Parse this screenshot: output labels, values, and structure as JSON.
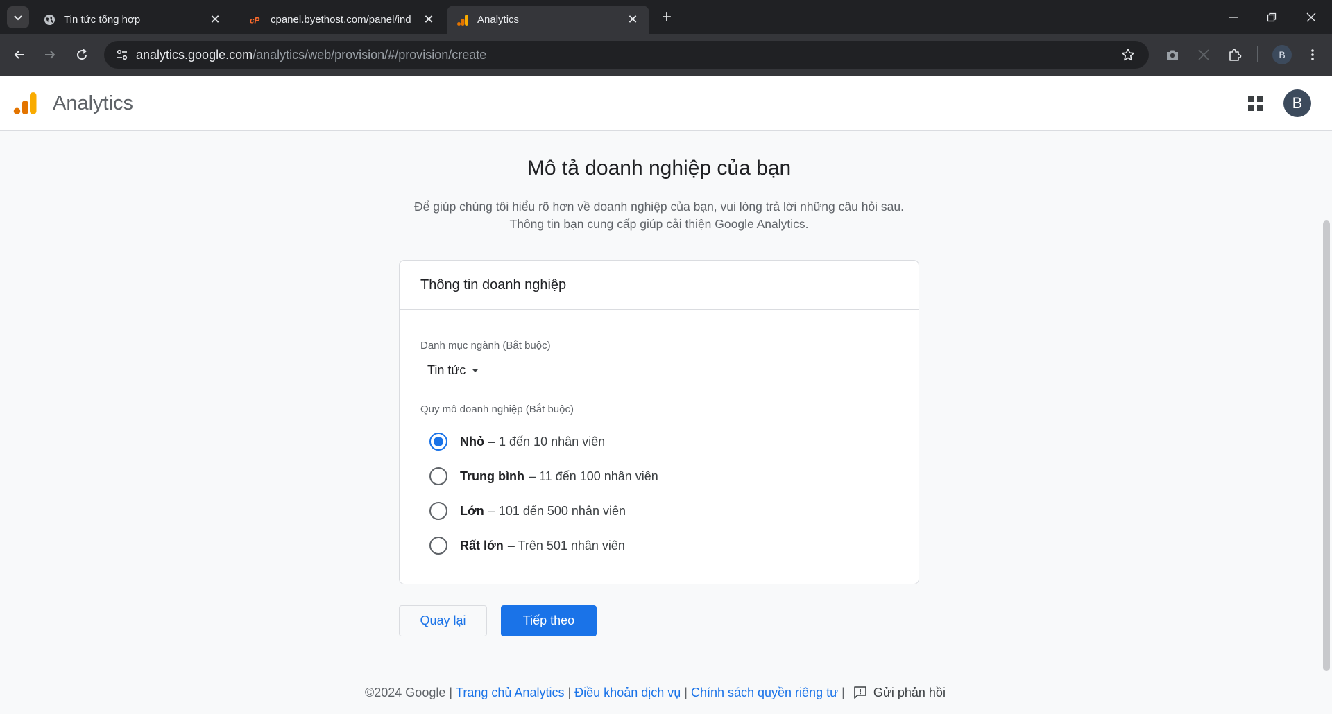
{
  "browser": {
    "tabs": [
      {
        "title": "Tin tức tổng hợp",
        "favicon": "globe-icon",
        "active": false
      },
      {
        "title": "cpanel.byethost.com/panel/ind",
        "favicon": "cpanel-icon",
        "active": false
      },
      {
        "title": "Analytics",
        "favicon": "analytics-icon",
        "active": true
      }
    ],
    "address": {
      "host": "analytics.google.com",
      "path": "/analytics/web/provision/#/provision/create"
    },
    "profile_initial": "B"
  },
  "app": {
    "name": "Analytics",
    "user_initial": "B",
    "brand_colors": {
      "logo_dark": "#e37400",
      "logo_light": "#f9ab00",
      "accent": "#1a73e8"
    }
  },
  "page": {
    "title": "Mô tả doanh nghiệp của bạn",
    "description_line1": "Để giúp chúng tôi hiểu rõ hơn về doanh nghiệp của bạn, vui lòng trả lời những câu hỏi sau.",
    "description_line2": "Thông tin bạn cung cấp giúp cải thiện Google Analytics."
  },
  "card": {
    "title": "Thông tin doanh nghiệp",
    "industry": {
      "label": "Danh mục ngành (Bắt buộc)",
      "selected": "Tin tức"
    },
    "size": {
      "label": "Quy mô doanh nghiệp (Bắt buộc)",
      "options": [
        {
          "name": "Nhỏ",
          "detail": "– 1 đến 10 nhân viên",
          "checked": true
        },
        {
          "name": "Trung bình",
          "detail": "– 11 đến 100 nhân viên",
          "checked": false
        },
        {
          "name": "Lớn",
          "detail": "– 101 đến 500 nhân viên",
          "checked": false
        },
        {
          "name": "Rất lớn",
          "detail": "– Trên 501 nhân viên",
          "checked": false
        }
      ]
    }
  },
  "buttons": {
    "back": "Quay lại",
    "next": "Tiếp theo"
  },
  "footer": {
    "copyright": "©2024 Google",
    "links": [
      "Trang chủ Analytics",
      "Điều khoản dịch vụ",
      "Chính sách quyền riêng tư"
    ],
    "feedback": "Gửi phản hồi"
  }
}
